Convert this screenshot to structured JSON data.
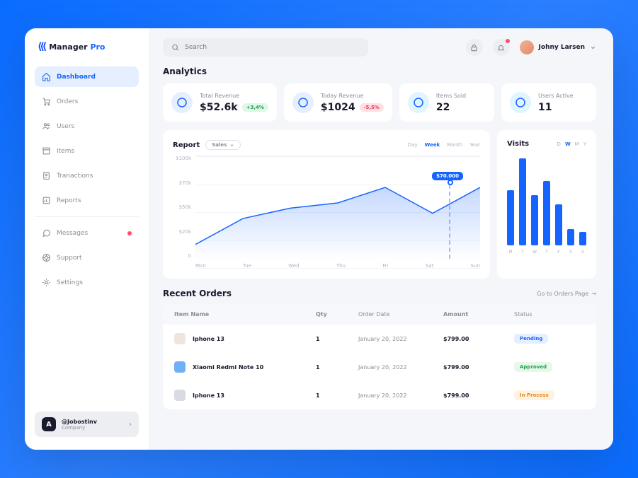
{
  "brand": {
    "name": "Manager",
    "suffix": "Pro"
  },
  "search": {
    "placeholder": "Search"
  },
  "user": {
    "name": "Johny Larsen"
  },
  "nav": [
    {
      "label": "Dashboard",
      "icon": "home",
      "active": true
    },
    {
      "label": "Orders",
      "icon": "cart"
    },
    {
      "label": "Users",
      "icon": "users"
    },
    {
      "label": "Items",
      "icon": "store"
    },
    {
      "label": "Tranactions",
      "icon": "doc"
    },
    {
      "label": "Reports",
      "icon": "report"
    }
  ],
  "nav2": [
    {
      "label": "Messages",
      "icon": "chat",
      "dot": true
    },
    {
      "label": "Support",
      "icon": "life"
    },
    {
      "label": "Settings",
      "icon": "gear"
    }
  ],
  "company": {
    "handle": "@Jobostinv",
    "sub": "Company"
  },
  "sections": {
    "analytics": "Analytics",
    "report": "Report",
    "visits": "Visits",
    "orders": "Recent Orders",
    "ordersLink": "Go to Orders Page"
  },
  "stats": [
    {
      "label": "Total Revenue",
      "value": "$52.6k",
      "delta": "+3,4%",
      "deltaClass": "up",
      "icon": "chart"
    },
    {
      "label": "Today Revenue",
      "value": "$1024",
      "delta": "-5,5%",
      "deltaClass": "down",
      "icon": "calendar"
    },
    {
      "label": "Items Sold",
      "value": "22",
      "icon": "box"
    },
    {
      "label": "Users Active",
      "value": "11",
      "icon": "head"
    }
  ],
  "report": {
    "dropdown": "Sales",
    "ranges": [
      "Day",
      "Week",
      "Month",
      "Year"
    ],
    "activeRange": "Week",
    "tooltip": "$70.000"
  },
  "visitsPanel": {
    "ranges": [
      "D",
      "W",
      "M",
      "Y"
    ],
    "activeRange": "W"
  },
  "chart_data": [
    {
      "type": "area",
      "title": "Report – Sales (Week)",
      "xlabel": "",
      "ylabel": "",
      "ylim": [
        0,
        100
      ],
      "yticks": [
        0,
        20,
        50,
        70,
        100
      ],
      "ytick_labels": [
        "0",
        "$20k",
        "$50k",
        "$70k",
        "$100k"
      ],
      "categories": [
        "Mon",
        "Tue",
        "Wed",
        "Thu",
        "Fri",
        "Sat",
        "Sun"
      ],
      "values": [
        15,
        40,
        50,
        55,
        70,
        45,
        70
      ],
      "highlight": {
        "x": "between Sat and Sun",
        "value": 70,
        "label": "$70.000"
      }
    },
    {
      "type": "bar",
      "title": "Visits (Week)",
      "xlabel": "",
      "ylabel": "",
      "ylim": [
        0,
        100
      ],
      "categories": [
        "M",
        "T",
        "W",
        "T",
        "F",
        "S",
        "S"
      ],
      "values": [
        60,
        95,
        55,
        70,
        45,
        18,
        15
      ]
    }
  ],
  "table": {
    "headers": {
      "item": "Item Name",
      "qty": "Qty",
      "date": "Order Date",
      "amount": "Amount",
      "status": "Status"
    },
    "rows": [
      {
        "item": "Iphone 13",
        "qty": "1",
        "date": "January 20, 2022",
        "amount": "$799.00",
        "status": "Pending",
        "statusClass": "pending",
        "img": ""
      },
      {
        "item": "Xiaomi Redmi Note 10",
        "qty": "1",
        "date": "January 20, 2022",
        "amount": "$799.00",
        "status": "Approved",
        "statusClass": "approved",
        "img": "blue"
      },
      {
        "item": "Iphone 13",
        "qty": "1",
        "date": "January 20, 2022",
        "amount": "$799.00",
        "status": "In Process",
        "statusClass": "process",
        "img": "gray"
      }
    ]
  }
}
